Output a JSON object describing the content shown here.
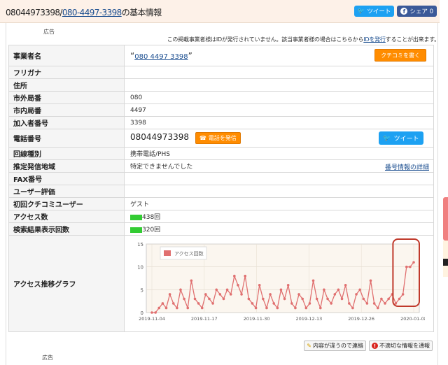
{
  "header": {
    "number_plain": "08044973398",
    "separator": "/",
    "number_link": "080-4497-3398",
    "suffix": "の基本情報",
    "tweet_label": "ツイート",
    "share_label": "シェア 0"
  },
  "ad_label": "広告",
  "notice": {
    "text_before": "この掲載事業者様はIDが発行されていません。該当事業者様の場合はこちらから",
    "link": "IDを発行",
    "text_after": "することが出来ます。"
  },
  "rows": {
    "business_name": {
      "label": "事業者名",
      "value": "080 4497 3398",
      "button": "クチコミを書く"
    },
    "furigana": {
      "label": "フリガナ",
      "value": ""
    },
    "address": {
      "label": "住所",
      "value": ""
    },
    "area_code": {
      "label": "市外局番",
      "value": "080"
    },
    "local_code": {
      "label": "市内局番",
      "value": "4497"
    },
    "subscriber": {
      "label": "加入者番号",
      "value": "3398"
    },
    "phone": {
      "label": "電話番号",
      "value": "08044973398",
      "call_button": "電話を発信",
      "tweet": "ツイート"
    },
    "line_type": {
      "label": "回線種別",
      "value": "携帯電話/PHS"
    },
    "region": {
      "label": "推定発信地域",
      "value": "特定できませんでした",
      "link": "番号情報の詳細"
    },
    "fax": {
      "label": "FAX番号",
      "value": ""
    },
    "rating": {
      "label": "ユーザー評価",
      "value": ""
    },
    "first_user": {
      "label": "初回クチコミユーザー",
      "value": "ゲスト"
    },
    "access": {
      "label": "アクセス数",
      "value": "438回"
    },
    "search": {
      "label": "検索結果表示回数",
      "value": "320回"
    },
    "graph": {
      "label": "アクセス推移グラフ"
    }
  },
  "chart_data": {
    "type": "line",
    "legend": "アクセス回数",
    "ylim": [
      0,
      15
    ],
    "yticks": [
      "0",
      "5",
      "10",
      "15"
    ],
    "xticks": [
      "2019-11-04",
      "2019-11-17",
      "2019-11-30",
      "2019-12-13",
      "2019-12-26",
      "2020-01-08"
    ],
    "series": [
      {
        "name": "アクセス回数",
        "color": "#e07070",
        "values": [
          0,
          0,
          1,
          2,
          1,
          4,
          2,
          1,
          5,
          3,
          1,
          7,
          3,
          2,
          1,
          4,
          3,
          2,
          5,
          4,
          3,
          5,
          4,
          8,
          6,
          4,
          8,
          3,
          2,
          1,
          6,
          3,
          1,
          4,
          2,
          1,
          5,
          3,
          6,
          2,
          1,
          4,
          3,
          1,
          2,
          7,
          3,
          1,
          5,
          3,
          2,
          4,
          5,
          3,
          6,
          2,
          1,
          4,
          5,
          3,
          2,
          7,
          2,
          1,
          3,
          2,
          3,
          4,
          2,
          3,
          4,
          10,
          10,
          11
        ]
      }
    ],
    "highlight_color": "#c0392b"
  },
  "bottom_buttons": {
    "wrong": "内容が違うので連絡",
    "report": "不適切な情報を通報"
  }
}
